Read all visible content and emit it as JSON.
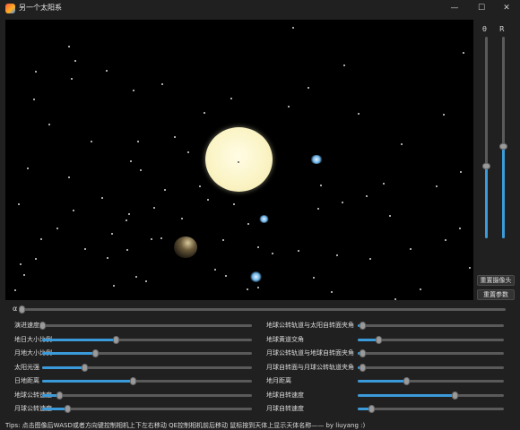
{
  "window": {
    "title": "另一个太阳系",
    "minimize_glyph": "—",
    "maximize_glyph": "☐",
    "close_glyph": "✕"
  },
  "scene": {
    "background": "#000000",
    "sun_color": "#fbf4c6",
    "planet_color": "#6ab2e6"
  },
  "camera_sliders": [
    {
      "label": "θ",
      "level": 0.36
    },
    {
      "label": "R",
      "level": 0.46
    }
  ],
  "buttons": {
    "reset_camera": "重置摄像头",
    "reset_params": "重置参数"
  },
  "alpha": {
    "label": "α",
    "level": 0.0
  },
  "left_sliders": [
    {
      "label": "演进速度",
      "level": 0.0
    },
    {
      "label": "地日大小比例",
      "level": 0.35
    },
    {
      "label": "月地大小比例",
      "level": 0.25
    },
    {
      "label": "太阳光强",
      "level": 0.2
    },
    {
      "label": "日地距离",
      "level": 0.43
    },
    {
      "label": "地球公转速度",
      "level": 0.08
    },
    {
      "label": "月球公转速度",
      "level": 0.12
    }
  ],
  "right_sliders": [
    {
      "label": "地球公转轨道与太阳自转面夹角",
      "level": 0.03
    },
    {
      "label": "地球黄道交角",
      "level": 0.14
    },
    {
      "label": "月球公转轨道与地球自转面夹角",
      "level": 0.03
    },
    {
      "label": "月球自转面与月球公转轨道夹角",
      "level": 0.03
    },
    {
      "label": "地月距离",
      "level": 0.33
    },
    {
      "label": "地球自转速度",
      "level": 0.66
    },
    {
      "label": "月球自转速度",
      "level": 0.09
    }
  ],
  "accent_color": "#3b9ad9",
  "tips": "Tips: 点击图像后WASD或者方向键控制相机上下左右移动 QE控制相机前后移动 鼠标按到天体上显示天体名称—— by liuyang :)"
}
